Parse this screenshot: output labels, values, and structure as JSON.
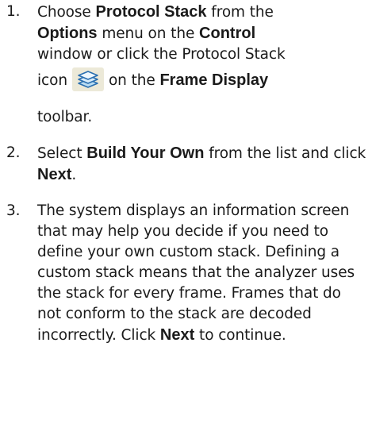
{
  "steps": [
    {
      "number": "1.",
      "line1_a": "Choose ",
      "line1_bold": "Protocol Stack",
      "line1_b": " from the",
      "line2_bold1": "Options",
      "line2_a": " menu on the ",
      "line2_bold2": "Control",
      "line3": "window or click the Protocol Stack",
      "line4_a": "icon",
      "icon": "protocol-stack-icon",
      "line4_b": "on the ",
      "line4_bold": "Frame Display",
      "line5": "toolbar."
    },
    {
      "number": "2.",
      "a": "Select ",
      "bold1": "Build Your Own",
      "b": " from the list and click ",
      "bold2": "Next",
      "c": "."
    },
    {
      "number": "3.",
      "text": "The system displays an information screen that may help you decide if you need to define your own custom stack. Defining a custom stack means that the analyzer uses the stack for every frame. Frames that do not conform to the stack are decoded incorrectly. Click ",
      "bold": "Next",
      "end": " to continue."
    }
  ]
}
